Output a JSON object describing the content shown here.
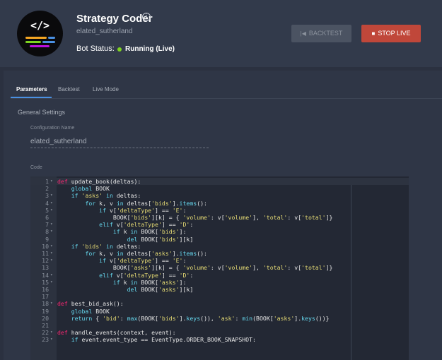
{
  "header": {
    "title": "Strategy Coder",
    "subtitle": "elated_sutherland",
    "status_label": "Bot Status:",
    "status_value": "Running (Live)",
    "logo_text": "</>",
    "buttons": {
      "backtest": "BACKTEST",
      "stop": "STOP LIVE"
    }
  },
  "tabs": [
    {
      "label": "Parameters",
      "active": true
    },
    {
      "label": "Backtest",
      "active": false
    },
    {
      "label": "Live Mode",
      "active": false
    }
  ],
  "general_settings": {
    "section_title": "General Settings",
    "config_label": "Configuration Name",
    "config_value": "elated_sutherland",
    "code_label": "Code"
  },
  "colors": {
    "accent": "#4a90e2",
    "danger": "#c0473a",
    "running": "#7ed321"
  },
  "code_lines": [
    {
      "n": "1",
      "fold": true,
      "html": "<span class=\"kd\">def</span> update_book(deltas):"
    },
    {
      "n": "2",
      "fold": false,
      "html": "    <span class=\"kw\">global</span> BOOK"
    },
    {
      "n": "3",
      "fold": true,
      "html": "    <span class=\"kw\">if</span> <span class=\"str\">'asks'</span> <span class=\"kw\">in</span> deltas:"
    },
    {
      "n": "4",
      "fold": true,
      "html": "        <span class=\"kw\">for</span> k, v <span class=\"kw\">in</span> deltas[<span class=\"str\">'bids'</span>].<span class=\"fn\">items</span>():"
    },
    {
      "n": "5",
      "fold": true,
      "html": "            <span class=\"kw\">if</span> v[<span class=\"str\">'deltaType'</span>] == <span class=\"str\">'E'</span>:"
    },
    {
      "n": "6",
      "fold": false,
      "html": "                BOOK[<span class=\"str\">'bids'</span>][k] = { <span class=\"str\">'volume'</span>: v[<span class=\"str\">'volume'</span>], <span class=\"str\">'total'</span>: v[<span class=\"str\">'total'</span>]}"
    },
    {
      "n": "7",
      "fold": true,
      "html": "            <span class=\"kw\">elif</span> v[<span class=\"str\">'deltaType'</span>] == <span class=\"str\">'D'</span>:"
    },
    {
      "n": "8",
      "fold": true,
      "html": "                <span class=\"kw\">if</span> k <span class=\"kw\">in</span> BOOK[<span class=\"str\">'bids'</span>]:"
    },
    {
      "n": "9",
      "fold": false,
      "html": "                    <span class=\"kw\">del</span> BOOK[<span class=\"str\">'bids'</span>][k]"
    },
    {
      "n": "10",
      "fold": true,
      "html": "    <span class=\"kw\">if</span> <span class=\"str\">'bids'</span> <span class=\"kw\">in</span> deltas:"
    },
    {
      "n": "11",
      "fold": true,
      "html": "        <span class=\"kw\">for</span> k, v <span class=\"kw\">in</span> deltas[<span class=\"str\">'asks'</span>].<span class=\"fn\">items</span>():"
    },
    {
      "n": "12",
      "fold": true,
      "html": "            <span class=\"kw\">if</span> v[<span class=\"str\">'deltaType'</span>] == <span class=\"str\">'E'</span>:"
    },
    {
      "n": "13",
      "fold": false,
      "html": "                BOOK[<span class=\"str\">'asks'</span>][k] = { <span class=\"str\">'volume'</span>: v[<span class=\"str\">'volume'</span>], <span class=\"str\">'total'</span>: v[<span class=\"str\">'total'</span>]}"
    },
    {
      "n": "14",
      "fold": true,
      "html": "            <span class=\"kw\">elif</span> v[<span class=\"str\">'deltaType'</span>] == <span class=\"str\">'D'</span>:"
    },
    {
      "n": "15",
      "fold": true,
      "html": "                <span class=\"kw\">if</span> k <span class=\"kw\">in</span> BOOK[<span class=\"str\">'asks'</span>]:"
    },
    {
      "n": "16",
      "fold": false,
      "html": "                    <span class=\"kw\">del</span> BOOK[<span class=\"str\">'asks'</span>][k]"
    },
    {
      "n": "17",
      "fold": false,
      "html": ""
    },
    {
      "n": "18",
      "fold": true,
      "html": "<span class=\"kd\">def</span> best_bid_ask():"
    },
    {
      "n": "19",
      "fold": false,
      "html": "    <span class=\"kw\">global</span> BOOK"
    },
    {
      "n": "20",
      "fold": false,
      "html": "    <span class=\"kw\">return</span> { <span class=\"str\">'bid'</span>: <span class=\"fn\">max</span>(BOOK[<span class=\"str\">'bids'</span>].<span class=\"fn\">keys</span>()), <span class=\"str\">'ask'</span>: <span class=\"fn\">min</span>(BOOK[<span class=\"str\">'asks'</span>].<span class=\"fn\">keys</span>())}"
    },
    {
      "n": "21",
      "fold": false,
      "html": ""
    },
    {
      "n": "22",
      "fold": true,
      "html": "<span class=\"kd\">def</span> handle_events(context, event):"
    },
    {
      "n": "23",
      "fold": true,
      "html": "    <span class=\"kw\">if</span> event.event_type == EventType.ORDER_BOOK_SNAPSHOT:"
    }
  ]
}
